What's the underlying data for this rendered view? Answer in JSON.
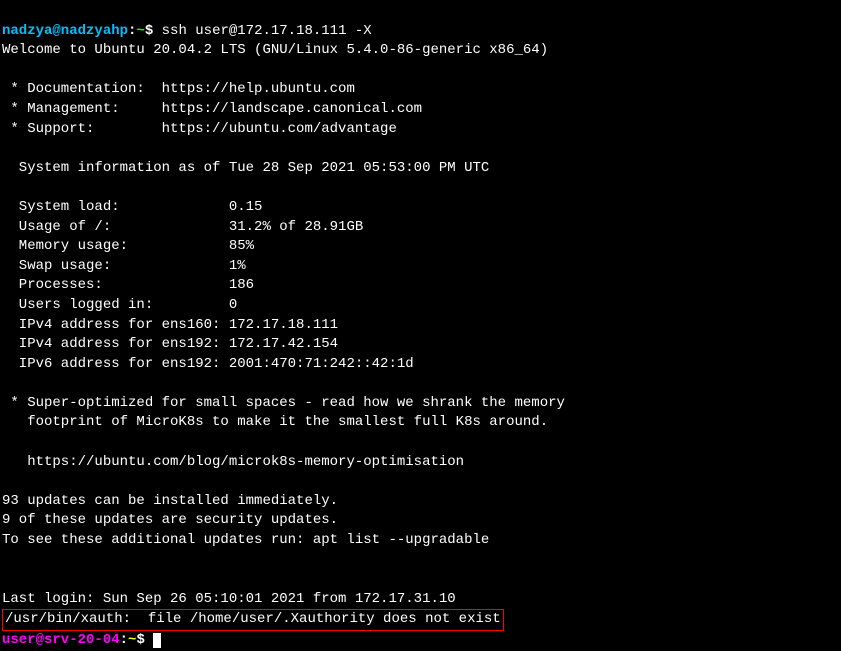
{
  "prompt1": {
    "user": "nadzya@nadzyahp",
    "sep": ":",
    "path": "~",
    "dollar": "$ ",
    "command": "ssh user@172.17.18.111 -X"
  },
  "welcome": "Welcome to Ubuntu 20.04.2 LTS (GNU/Linux 5.4.0-86-generic x86_64)",
  "links": {
    "doc": " * Documentation:  https://help.ubuntu.com",
    "mgmt": " * Management:     https://landscape.canonical.com",
    "support": " * Support:        https://ubuntu.com/advantage"
  },
  "sysinfo_header": "  System information as of Tue 28 Sep 2021 05:53:00 PM UTC",
  "sysinfo": {
    "load": "  System load:             0.15",
    "usage": "  Usage of /:              31.2% of 28.91GB",
    "memory": "  Memory usage:            85%",
    "swap": "  Swap usage:              1%",
    "processes": "  Processes:               186",
    "users": "  Users logged in:         0",
    "ipv4_1": "  IPv4 address for ens160: 172.17.18.111",
    "ipv4_2": "  IPv4 address for ens192: 172.17.42.154",
    "ipv6": "  IPv6 address for ens192: 2001:470:71:242::42:1d"
  },
  "microk8s": {
    "line1": " * Super-optimized for small spaces - read how we shrank the memory",
    "line2": "   footprint of MicroK8s to make it the smallest full K8s around.",
    "url": "   https://ubuntu.com/blog/microk8s-memory-optimisation"
  },
  "updates": {
    "line1": "93 updates can be installed immediately.",
    "line2": "9 of these updates are security updates.",
    "line3": "To see these additional updates run: apt list --upgradable"
  },
  "lastlogin": "Last login: Sun Sep 26 05:10:01 2021 from 172.17.31.10",
  "xauth": "/usr/bin/xauth:  file /home/user/.Xauthority does not exist",
  "prompt2": {
    "user": "user@srv-20-04",
    "sep": ":",
    "path": "~",
    "dollar": "$ "
  }
}
